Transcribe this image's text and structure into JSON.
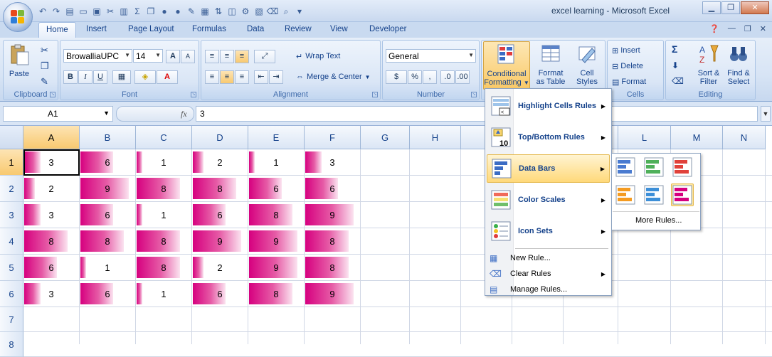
{
  "window": {
    "title": "excel learning - Microsoft Excel"
  },
  "tabs": [
    "Home",
    "Insert",
    "Page Layout",
    "Formulas",
    "Data",
    "Review",
    "View",
    "Developer"
  ],
  "ribbon": {
    "clipboard": {
      "label": "Clipboard",
      "paste": "Paste"
    },
    "font": {
      "label": "Font",
      "name": "BrowalliaUPC",
      "size": "14",
      "grow": "A",
      "shrink": "A",
      "bold": "B",
      "italic": "I",
      "underline": "U"
    },
    "alignment": {
      "label": "Alignment",
      "wrap": "Wrap Text",
      "merge": "Merge & Center"
    },
    "number": {
      "label": "Number",
      "format": "General",
      "percent": "%",
      "comma": ","
    },
    "styles": {
      "cf_line1": "Conditional",
      "cf_line2": "Formatting",
      "ft_line1": "Format",
      "ft_line2": "as Table",
      "cs_line1": "Cell",
      "cs_line2": "Styles"
    },
    "cells": {
      "label": "Cells",
      "insert": "Insert",
      "delete": "Delete",
      "format": "Format"
    },
    "editing": {
      "label": "Editing",
      "sort_line1": "Sort &",
      "sort_line2": "Filter",
      "find_line1": "Find &",
      "find_line2": "Select"
    }
  },
  "formula_bar": {
    "name_box": "A1",
    "fx": "fx",
    "content": "3"
  },
  "columns": [
    "A",
    "B",
    "C",
    "D",
    "E",
    "F",
    "G",
    "H",
    "I",
    "J",
    "K",
    "L",
    "M",
    "N"
  ],
  "rows": [
    "1",
    "2",
    "3",
    "4",
    "5",
    "6",
    "7",
    "8"
  ],
  "cells": [
    [
      3,
      6,
      1,
      2,
      1,
      3
    ],
    [
      2,
      9,
      8,
      8,
      6,
      6
    ],
    [
      3,
      6,
      1,
      6,
      8,
      9
    ],
    [
      8,
      8,
      8,
      9,
      9,
      8
    ],
    [
      6,
      1,
      8,
      2,
      9,
      8
    ],
    [
      3,
      6,
      1,
      6,
      8,
      9
    ]
  ],
  "data_bar_color": "#d6007f",
  "cf_menu": {
    "items": [
      {
        "label": "Highlight Cells Rules",
        "icon": "highlight-cells-icon",
        "submenu": true
      },
      {
        "label": "Top/Bottom Rules",
        "icon": "top-bottom-icon",
        "submenu": true
      },
      {
        "label": "Data Bars",
        "icon": "data-bars-icon",
        "submenu": true,
        "highlighted": true
      },
      {
        "label": "Color Scales",
        "icon": "color-scales-icon",
        "submenu": true
      },
      {
        "label": "Icon Sets",
        "icon": "icon-sets-icon",
        "submenu": true
      }
    ],
    "small_items": [
      {
        "label": "New Rule...",
        "submenu": false
      },
      {
        "label": "Clear Rules",
        "submenu": true
      },
      {
        "label": "Manage Rules...",
        "submenu": false
      }
    ]
  },
  "data_bars_menu": {
    "swatches": [
      "#4a7bd0",
      "#4fb05a",
      "#e0413a",
      "#f49b21",
      "#3d8fd8",
      "#d6007f"
    ],
    "selected_index": 5,
    "more_rules": "More Rules..."
  }
}
